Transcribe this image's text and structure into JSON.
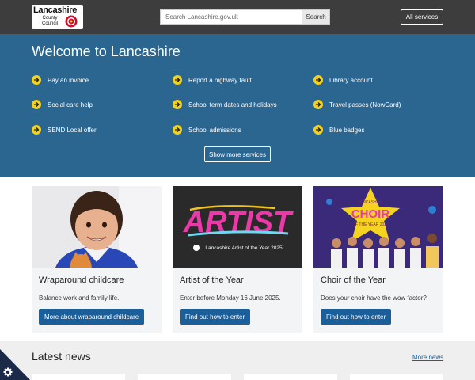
{
  "header": {
    "logo_line1": "Lancashire",
    "logo_line2": "County",
    "logo_line3": "Council",
    "search_placeholder": "Search Lancashire.gov.uk",
    "search_button": "Search",
    "all_services": "All services"
  },
  "hero": {
    "title": "Welcome to Lancashire",
    "services": [
      "Pay an invoice",
      "Report a highway fault",
      "Library account",
      "Social care help",
      "School term dates and holidays",
      "Travel passes (NowCard)",
      "SEND Local offer",
      "School admissions",
      "Blue badges"
    ],
    "show_more": "Show more services"
  },
  "cards": [
    {
      "title": "Wraparound childcare",
      "text": "Balance work and family life.",
      "button": "More about wraparound childcare"
    },
    {
      "title": "Artist of the Year",
      "text": "Enter before Monday 16 June 2025.",
      "button": "Find out how to enter",
      "img_word": "ARTIST",
      "img_caption": "Lancashire Artist of the Year 2025"
    },
    {
      "title": "Choir of the Year",
      "text": "Does your choir have the wow factor?",
      "button": "Find out how to enter",
      "img_top": "LANCASHIRE",
      "img_word": "CHOIR",
      "img_caption": "OF THE YEAR 2025"
    }
  ],
  "news": {
    "title": "Latest news",
    "more": "More news"
  },
  "colors": {
    "header": "#3d3d3d",
    "hero": "#2b6690",
    "accent": "#f2d21b",
    "button": "#1a5e9a"
  }
}
